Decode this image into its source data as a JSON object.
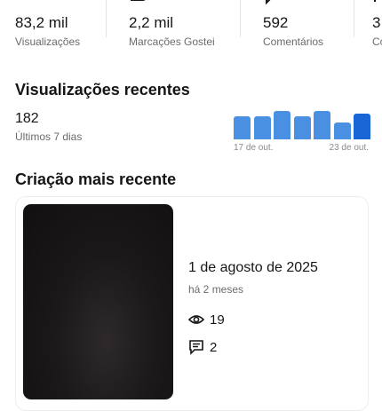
{
  "stats": [
    {
      "value": "83,2 mil",
      "label": "Visualizações",
      "icon": "eye-icon"
    },
    {
      "value": "2,2 mil",
      "label": "Marcações Gostei",
      "icon": "like-icon"
    },
    {
      "value": "592",
      "label": "Comentários",
      "icon": "comment-icon"
    },
    {
      "value": "3",
      "label": "Co",
      "icon": "share-icon"
    }
  ],
  "recent_views": {
    "title": "Visualizações recentes",
    "count": "182",
    "period": "Últimos 7 dias",
    "chart_data": {
      "type": "bar",
      "values": [
        0.72,
        0.72,
        0.9,
        0.72,
        0.9,
        0.52,
        0.8
      ],
      "labels": [
        "17 de out.",
        "23 de out."
      ],
      "bar_color": "#4a90e2",
      "highlight_color": "#1a66d6"
    }
  },
  "latest_creation": {
    "title": "Criação mais recente",
    "date": "1 de agosto de 2025",
    "ago": "há 2 meses",
    "views": "19",
    "comments": "2"
  }
}
